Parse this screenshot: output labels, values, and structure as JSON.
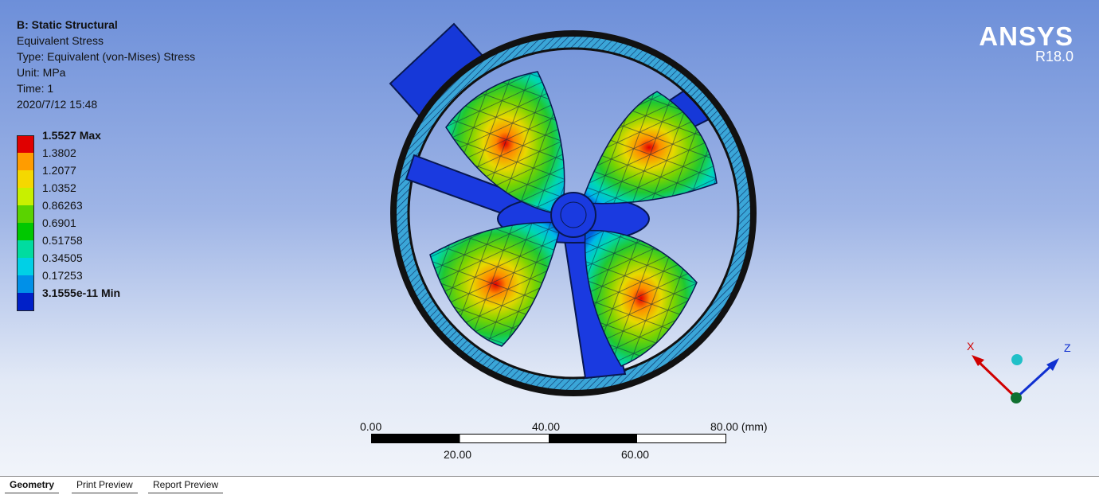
{
  "info": {
    "analysis": "B: Static Structural",
    "result": "Equivalent Stress",
    "type": "Type: Equivalent (von-Mises) Stress",
    "unit": "Unit: MPa",
    "time": "Time: 1",
    "date": "2020/7/12 15:48"
  },
  "legend": [
    {
      "label": "1.5527 Max",
      "color": "#e00000",
      "bold": true
    },
    {
      "label": "1.3802",
      "color": "#ff9c00",
      "bold": false
    },
    {
      "label": "1.2077",
      "color": "#f5d800",
      "bold": false
    },
    {
      "label": "1.0352",
      "color": "#c8f000",
      "bold": false
    },
    {
      "label": "0.86263",
      "color": "#5ad300",
      "bold": false
    },
    {
      "label": "0.6901",
      "color": "#00c800",
      "bold": false
    },
    {
      "label": "0.51758",
      "color": "#00dca0",
      "bold": false
    },
    {
      "label": "0.34505",
      "color": "#00d0e6",
      "bold": false
    },
    {
      "label": "0.17253",
      "color": "#0090e8",
      "bold": false
    },
    {
      "label": "3.1555e-11 Min",
      "color": "#0020c8",
      "bold": true
    }
  ],
  "logo": {
    "name": "ANSYS",
    "version": "R18.0"
  },
  "scale_bar": {
    "top_labels": [
      "0.00",
      "40.00",
      "80.00 (mm)"
    ],
    "bottom_labels": [
      "20.00",
      "60.00"
    ]
  },
  "triad": {
    "x": "X",
    "z": "Z"
  },
  "tabs": [
    "Geometry",
    "Print Preview",
    "Report Preview"
  ]
}
